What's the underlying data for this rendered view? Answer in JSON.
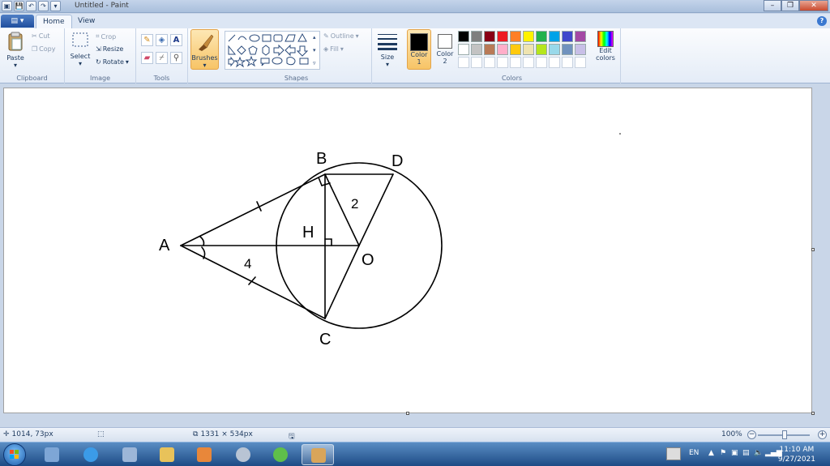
{
  "window": {
    "title": "Untitled - Paint",
    "controls": {
      "minimize": "–",
      "maximize": "❐",
      "close": "✕"
    }
  },
  "qat": {
    "app_menu_glyph": "▤ ▾",
    "save": "💾",
    "undo": "↶",
    "redo": "↷",
    "more": "▾"
  },
  "tabs": {
    "home": "Home",
    "view": "View",
    "help": "?"
  },
  "ribbon": {
    "clipboard": {
      "label": "Clipboard",
      "paste": "Paste",
      "cut": "Cut",
      "copy": "Copy"
    },
    "image": {
      "label": "Image",
      "select": "Select",
      "crop": "Crop",
      "resize": "Resize",
      "rotate": "Rotate"
    },
    "tools": {
      "label": "Tools"
    },
    "brushes": {
      "label": "Brushes"
    },
    "shapes": {
      "label": "Shapes",
      "outline": "Outline",
      "fill": "Fill"
    },
    "size": {
      "label": "Size"
    },
    "colors": {
      "label": "Colors",
      "color1_line1": "Color",
      "color1_line2": "1",
      "color2_line1": "Color",
      "color2_line2": "2",
      "edit_line1": "Edit",
      "edit_line2": "colors",
      "color1": "#000000",
      "color2": "#ffffff",
      "palette": [
        "#000000",
        "#7f7f7f",
        "#880015",
        "#ed1c24",
        "#ff7f27",
        "#fff200",
        "#22b14c",
        "#00a2e8",
        "#3f48cc",
        "#a349a4",
        "#ffffff",
        "#c3c3c3",
        "#b97a57",
        "#ffaec9",
        "#ffc90e",
        "#efe4b0",
        "#b5e61d",
        "#99d9ea",
        "#7092be",
        "#c8bfe7",
        "#ffffff",
        "#ffffff",
        "#ffffff",
        "#ffffff",
        "#ffffff",
        "#ffffff",
        "#ffffff",
        "#ffffff",
        "#ffffff",
        "#ffffff"
      ]
    }
  },
  "drawing": {
    "labels": {
      "A": "A",
      "B": "B",
      "C": "C",
      "D": "D",
      "H": "H",
      "O": "O",
      "two": "2",
      "four": "4"
    }
  },
  "statusbar": {
    "cursor_pos": "1014, 73px",
    "canvas_size": "1331 × 534px",
    "zoom": "100%"
  },
  "taskbar": {
    "language": "EN",
    "time": "11:10 AM",
    "date": "9/27/2021"
  }
}
